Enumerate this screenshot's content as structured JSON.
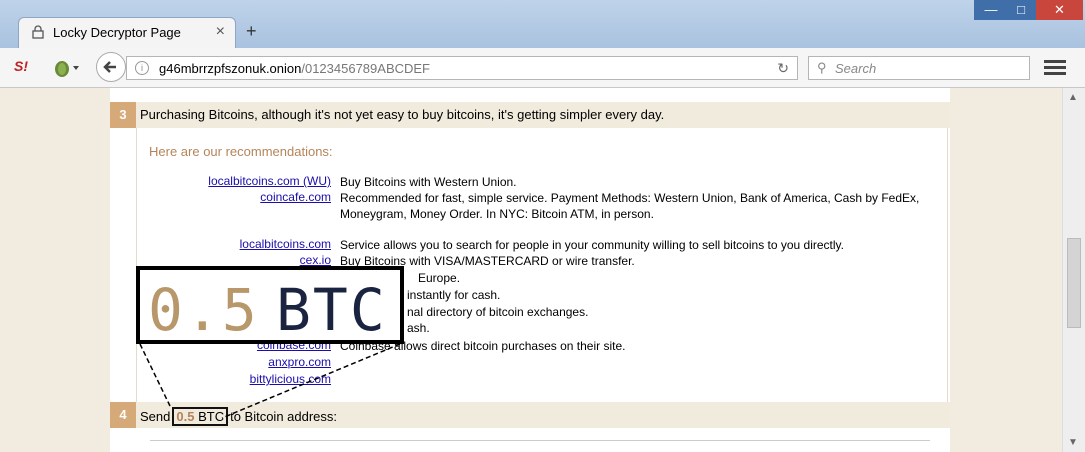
{
  "browser": {
    "tab_title": "Locky Decryptor Page",
    "tab_close": "×",
    "new_tab": "+",
    "url_host": "g46mbrrzpfszonuk.onion",
    "url_path": "/0123456789ABCDEF",
    "search_placeholder": "Search",
    "addon_label": "S!",
    "window_controls": {
      "minimize": "—",
      "maximize": "□",
      "close": "✕"
    }
  },
  "step3": {
    "number": "3",
    "text": "Purchasing Bitcoins, although it's not yet easy to buy bitcoins, it's getting simpler every day.",
    "recommendations_heading": "Here are our recommendations:",
    "sites": [
      {
        "name": "localbitcoins.com (WU)",
        "desc": "Buy Bitcoins with Western Union."
      },
      {
        "name": "coincafe.com",
        "desc": "Recommended for fast, simple service. Payment Methods: Western Union, Bank of America, Cash by FedEx, Moneygram, Money Order. In NYC: Bitcoin ATM, in person."
      },
      {
        "name": "localbitcoins.com",
        "desc": "Service allows you to search for people in your community willing to sell bitcoins to you directly."
      },
      {
        "name": "cex.io",
        "desc": "Buy Bitcoins with VISA/MASTERCARD or wire transfer."
      },
      {
        "name": "",
        "desc": "Europe."
      },
      {
        "name": "",
        "desc": "instantly for cash."
      },
      {
        "name": "",
        "desc": "nal directory of bitcoin exchanges."
      },
      {
        "name": "",
        "desc": "ash."
      },
      {
        "name": "coinbase.com",
        "desc": "Coinbase allows direct bitcoin purchases on their site."
      },
      {
        "name": "anxpro.com",
        "desc": ""
      },
      {
        "name": "bittylicious.com",
        "desc": ""
      }
    ]
  },
  "step4": {
    "number": "4",
    "prefix": "Send",
    "amount": "0.5",
    "unit": "BTC",
    "suffix": "to Bitcoin address:"
  },
  "zoom": {
    "amount": "0.5",
    "unit": "BTC"
  }
}
